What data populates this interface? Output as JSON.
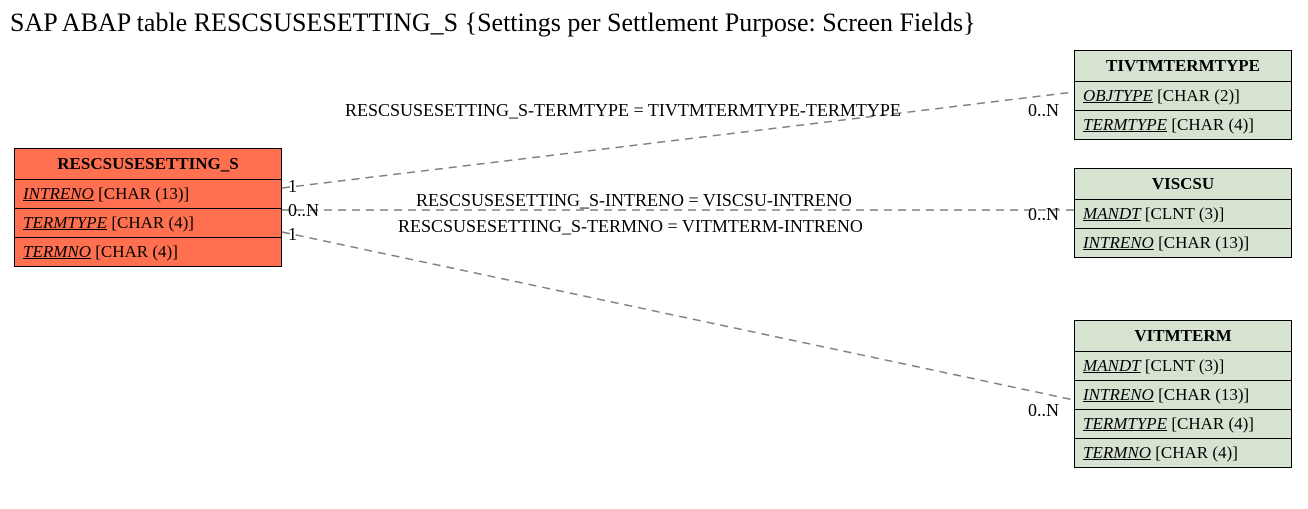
{
  "title": "SAP ABAP table RESCSUSESETTING_S {Settings per Settlement Purpose: Screen Fields}",
  "left_entity": {
    "name": "RESCSUSESETTING_S",
    "fields": [
      {
        "name": "INTRENO",
        "type": "[CHAR (13)]"
      },
      {
        "name": "TERMTYPE",
        "type": "[CHAR (4)]"
      },
      {
        "name": "TERMNO",
        "type": "[CHAR (4)]"
      }
    ]
  },
  "right_entities": [
    {
      "name": "TIVTMTERMTYPE",
      "fields": [
        {
          "name": "OBJTYPE",
          "type": "[CHAR (2)]"
        },
        {
          "name": "TERMTYPE",
          "type": "[CHAR (4)]"
        }
      ]
    },
    {
      "name": "VISCSU",
      "fields": [
        {
          "name": "MANDT",
          "type": "[CLNT (3)]"
        },
        {
          "name": "INTRENO",
          "type": "[CHAR (13)]"
        }
      ]
    },
    {
      "name": "VITMTERM",
      "fields": [
        {
          "name": "MANDT",
          "type": "[CLNT (3)]"
        },
        {
          "name": "INTRENO",
          "type": "[CHAR (13)]"
        },
        {
          "name": "TERMTYPE",
          "type": "[CHAR (4)]"
        },
        {
          "name": "TERMNO",
          "type": "[CHAR (4)]"
        }
      ]
    }
  ],
  "edges": [
    {
      "label": "RESCSUSESETTING_S-TERMTYPE = TIVTMTERMTYPE-TERMTYPE",
      "left_card": "1",
      "right_card": "0..N"
    },
    {
      "label": "RESCSUSESETTING_S-INTRENO = VISCSU-INTRENO",
      "left_card": "0..N",
      "right_card": "0..N"
    },
    {
      "label": "RESCSUSESETTING_S-TERMNO = VITMTERM-INTRENO",
      "left_card": "1",
      "right_card": "0..N"
    }
  ]
}
